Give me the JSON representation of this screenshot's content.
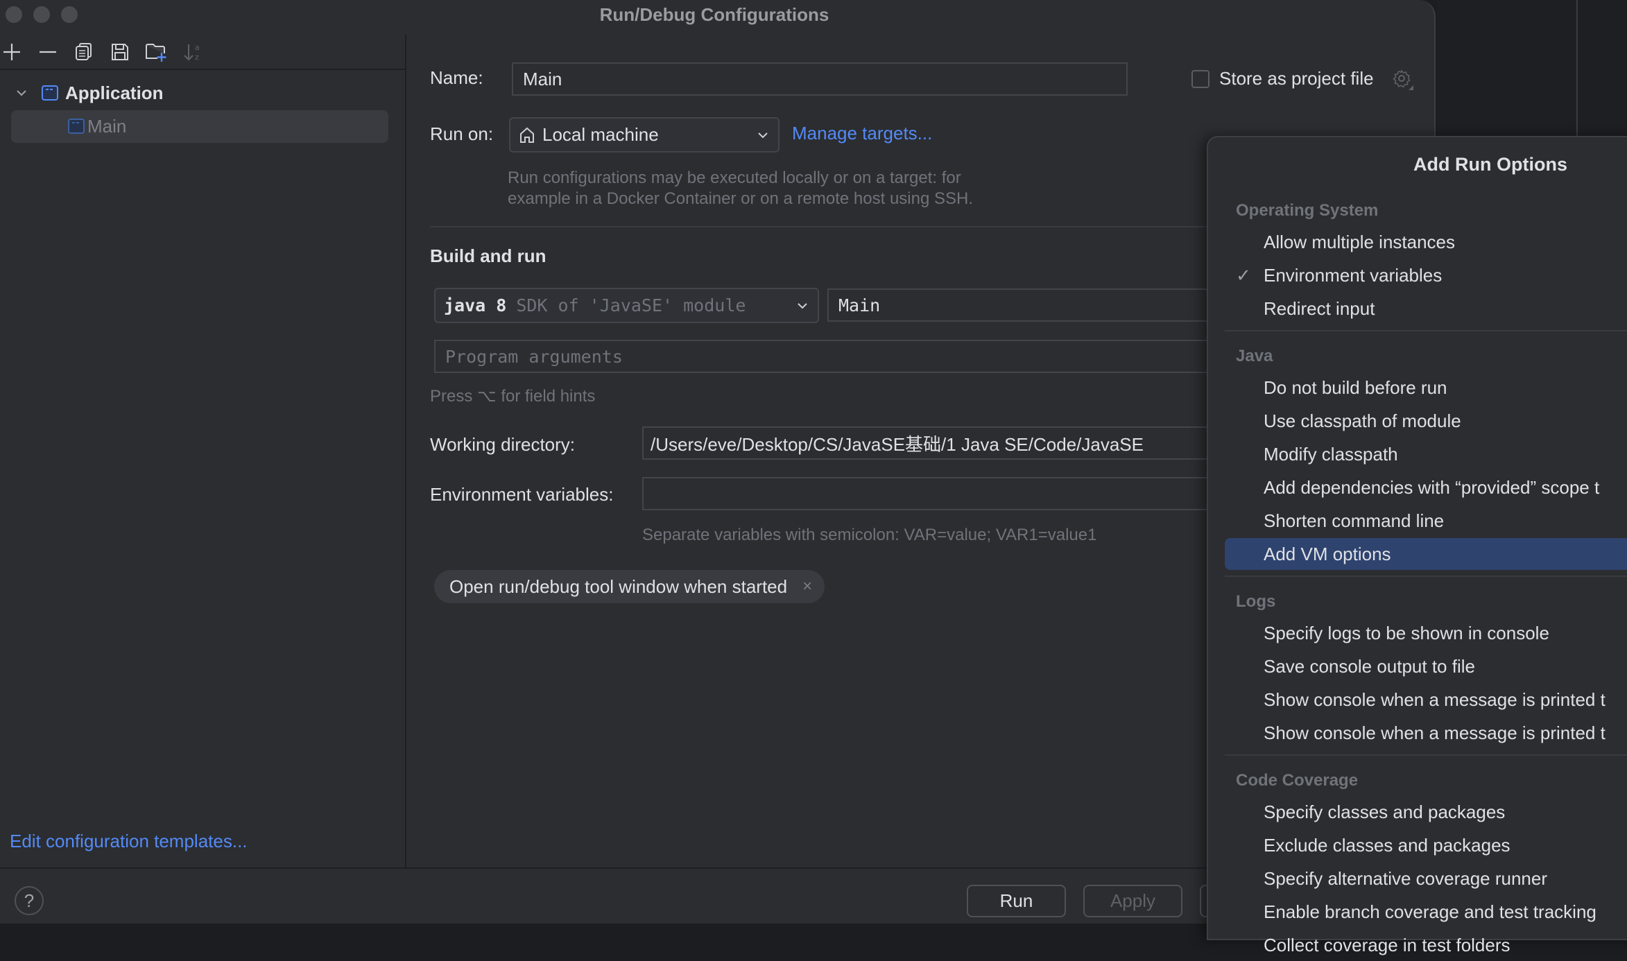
{
  "window": {
    "title": "Run/Debug Configurations"
  },
  "toolbar": {
    "icons": [
      "add-icon",
      "remove-icon",
      "copy-icon",
      "save-icon",
      "new-folder-icon",
      "sort-icon"
    ]
  },
  "sidebar": {
    "tree": {
      "group_label": "Application",
      "items": [
        {
          "label": "Main",
          "selected": true
        }
      ]
    },
    "edit_templates_link": "Edit configuration templates..."
  },
  "form": {
    "name_label": "Name:",
    "name_value": "Main",
    "store_as_project_file_label": "Store as project file",
    "store_as_project_file_checked": false,
    "run_on_label": "Run on:",
    "run_on_value": "Local machine",
    "manage_targets_link": "Manage targets...",
    "run_on_hint_line1": "Run configurations may be executed locally or on a target: for",
    "run_on_hint_line2": "example in a Docker Container or on a remote host using SSH.",
    "build_and_run_title": "Build and run",
    "jdk_value": "java 8",
    "jdk_hint": "SDK of 'JavaSE' module",
    "main_class_value": "Main",
    "program_arguments_placeholder": "Program arguments",
    "field_hints_text": "Press ⌥ for field hints",
    "working_directory_label": "Working directory:",
    "working_directory_value": "/Users/eve/Desktop/CS/JavaSE基础/1 Java SE/Code/JavaSE",
    "env_vars_label": "Environment variables:",
    "env_vars_value": "",
    "env_vars_hint": "Separate variables with semicolon: VAR=value; VAR1=value1",
    "chip_label": "Open run/debug tool window when started",
    "chip_close": "×"
  },
  "footer": {
    "help": "?",
    "run_label": "Run",
    "apply_label": "Apply"
  },
  "popup": {
    "title": "Add Run Options",
    "groups": [
      {
        "label": "Operating System",
        "items": [
          {
            "label": "Allow multiple instances",
            "checked": false
          },
          {
            "label": "Environment variables",
            "checked": true
          },
          {
            "label": "Redirect input",
            "checked": false
          }
        ]
      },
      {
        "label": "Java",
        "items": [
          {
            "label": "Do not build before run",
            "checked": false
          },
          {
            "label": "Use classpath of module",
            "checked": false
          },
          {
            "label": "Modify classpath",
            "checked": false
          },
          {
            "label": "Add dependencies with “provided” scope t",
            "checked": false
          },
          {
            "label": "Shorten command line",
            "checked": false
          },
          {
            "label": "Add VM options",
            "checked": false,
            "highlighted": true
          }
        ]
      },
      {
        "label": "Logs",
        "items": [
          {
            "label": "Specify logs to be shown in console",
            "checked": false
          },
          {
            "label": "Save console output to file",
            "checked": false
          },
          {
            "label": "Show console when a message is printed t",
            "checked": false
          },
          {
            "label": "Show console when a message is printed t",
            "checked": false
          }
        ]
      },
      {
        "label": "Code Coverage",
        "items": [
          {
            "label": "Specify classes and packages",
            "checked": false
          },
          {
            "label": "Exclude classes and packages",
            "checked": false
          },
          {
            "label": "Specify alternative coverage runner",
            "checked": false
          },
          {
            "label": "Enable branch coverage and test tracking",
            "checked": false
          },
          {
            "label": "Collect coverage in test folders",
            "checked": false
          }
        ]
      }
    ],
    "check_glyph": "✓"
  },
  "colors": {
    "accent": "#548af7",
    "background": "#2b2d30",
    "selection": "#2e436e",
    "muted_text": "#6f737a"
  }
}
